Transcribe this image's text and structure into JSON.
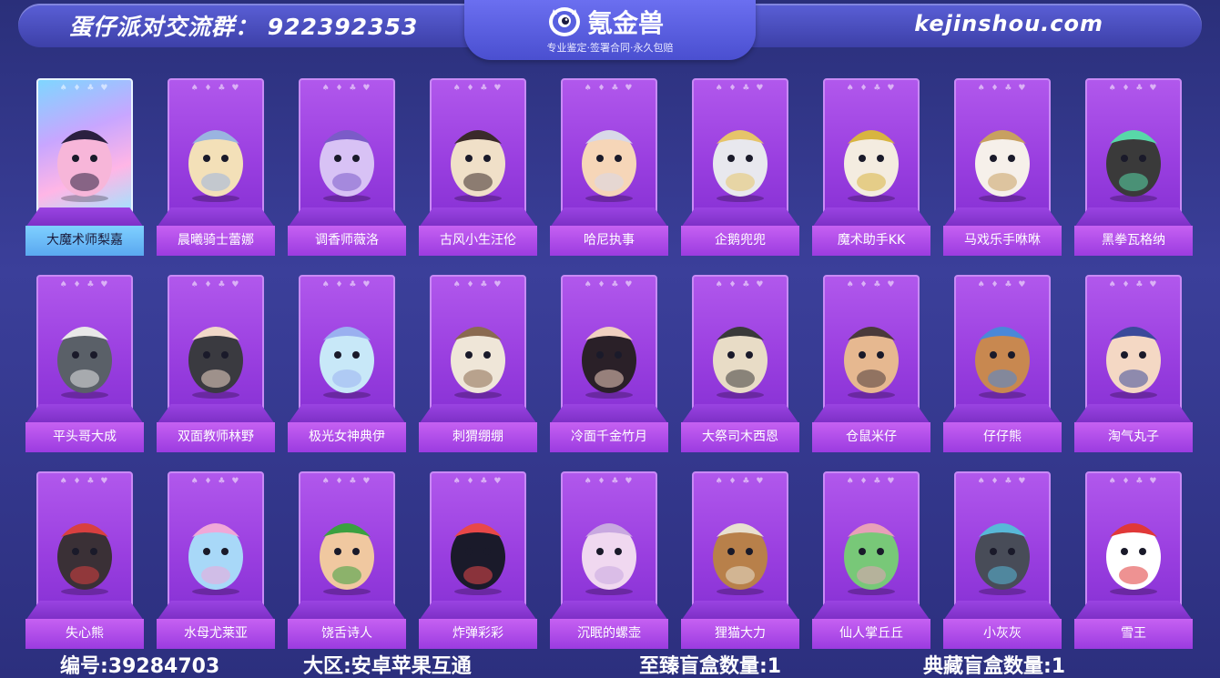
{
  "header": {
    "group_text": "蛋仔派对交流群：  922392353",
    "logo_name": "氪金兽",
    "logo_tagline": "专业鉴定·签署合同·永久包赔",
    "site": "kejinshou.com"
  },
  "cards": [
    {
      "label": "大魔术师梨嘉",
      "special": true,
      "color": "#f7b6d9",
      "accent": "#2b2040"
    },
    {
      "label": "晨曦骑士蕾娜",
      "special": false,
      "color": "#f3e0b8",
      "accent": "#9ab4e0"
    },
    {
      "label": "调香师薇洛",
      "special": false,
      "color": "#d8c2f5",
      "accent": "#7b5bc8"
    },
    {
      "label": "古风小生汪伦",
      "special": false,
      "color": "#f0e0c8",
      "accent": "#3a2a2a"
    },
    {
      "label": "哈尼执事",
      "special": false,
      "color": "#f6d6b8",
      "accent": "#d8d8e8"
    },
    {
      "label": "企鹅兜兜",
      "special": false,
      "color": "#e8e8ee",
      "accent": "#e6c46a"
    },
    {
      "label": "魔术助手KK",
      "special": false,
      "color": "#f4ece0",
      "accent": "#d8b440"
    },
    {
      "label": "马戏乐手咻咻",
      "special": false,
      "color": "#f6f0ea",
      "accent": "#c8a060"
    },
    {
      "label": "黑拳瓦格纳",
      "special": false,
      "color": "#3a3a3a",
      "accent": "#58d8a8"
    },
    {
      "label": "平头哥大成",
      "special": false,
      "color": "#5a6068",
      "accent": "#e8e8e8"
    },
    {
      "label": "双面教师林野",
      "special": false,
      "color": "#3a3a40",
      "accent": "#f0d8c8"
    },
    {
      "label": "极光女神典伊",
      "special": false,
      "color": "#c8e8f8",
      "accent": "#9ab0f0"
    },
    {
      "label": "刺猬绷绷",
      "special": false,
      "color": "#efe6d8",
      "accent": "#8a6a50"
    },
    {
      "label": "冷面千金竹月",
      "special": false,
      "color": "#2a2028",
      "accent": "#f0d0c0"
    },
    {
      "label": "大祭司木西恩",
      "special": false,
      "color": "#e8dcc6",
      "accent": "#3a3a3a"
    },
    {
      "label": "仓鼠米仔",
      "special": false,
      "color": "#e6b890",
      "accent": "#4a3a3a"
    },
    {
      "label": "仔仔熊",
      "special": false,
      "color": "#c88850",
      "accent": "#4a88d8"
    },
    {
      "label": "淘气丸子",
      "special": false,
      "color": "#f4d8c4",
      "accent": "#3a4a9a"
    },
    {
      "label": "失心熊",
      "special": false,
      "color": "#3a3036",
      "accent": "#d84040"
    },
    {
      "label": "水母尤莱亚",
      "special": false,
      "color": "#a8d8f8",
      "accent": "#f0a8d8"
    },
    {
      "label": "饶舌诗人",
      "special": false,
      "color": "#f0c8a0",
      "accent": "#3aa040"
    },
    {
      "label": "炸弹彩彩",
      "special": false,
      "color": "#1a1a2a",
      "accent": "#e84848"
    },
    {
      "label": "沉眠的螺壶",
      "special": false,
      "color": "#f0d8f0",
      "accent": "#c8a8e0"
    },
    {
      "label": "狸猫大力",
      "special": false,
      "color": "#b8804a",
      "accent": "#e8e0d0"
    },
    {
      "label": "仙人掌丘丘",
      "special": false,
      "color": "#78c878",
      "accent": "#e8a0b8"
    },
    {
      "label": "小灰灰",
      "special": false,
      "color": "#484c58",
      "accent": "#58b8d8"
    },
    {
      "label": "雪王",
      "special": false,
      "color": "#ffffff",
      "accent": "#e03838"
    }
  ],
  "footer": {
    "id_text": "编号:39284703",
    "region_text": "大区:安卓苹果互通",
    "supreme_box_text": "至臻盲盒数量:1",
    "collection_box_text": "典藏盲盒数量:1"
  },
  "suits_text": "♠ ♦ ♣ ♥"
}
